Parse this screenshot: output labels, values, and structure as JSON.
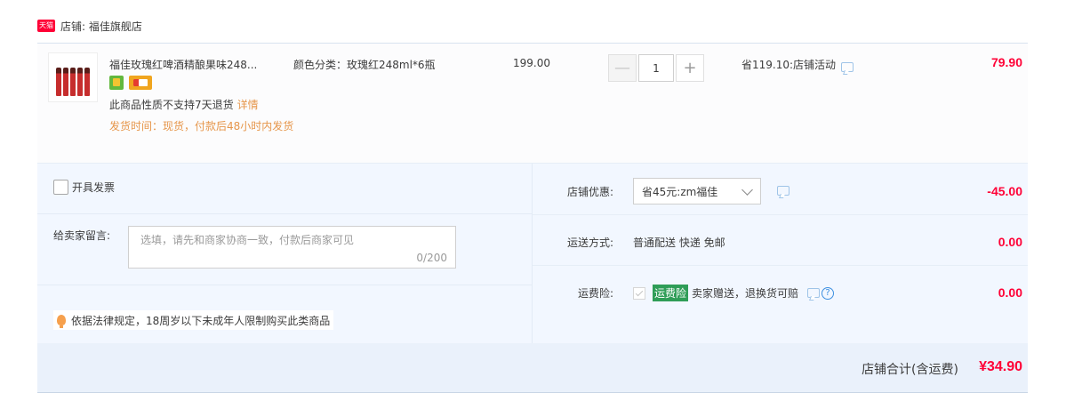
{
  "shop": {
    "badge": "天猫",
    "label": "店铺: 福佳旗舰店"
  },
  "item": {
    "title": "福佳玫瑰红啤酒精酿果味248...",
    "sku": "颜色分类：玫瑰红248ml*6瓶",
    "unit_price": "199.00",
    "notice": "此商品性质不支持7天退货",
    "detail_link": "详情",
    "ship_time": "发货时间：现货，付款后48小时内发货",
    "quantity": "1",
    "minus_label": "—",
    "plus_label": "+",
    "saving": "省119.10:店铺活动",
    "total": "79.90"
  },
  "extras": {
    "invoice_label": "开具发票",
    "message_label": "给卖家留言:",
    "message_placeholder": "选填，请先和商家协商一致，付款后商家可见",
    "message_counter": "0/200",
    "legal_notice": "依据法律规定，18周岁以下未成年人限制购买此类商品",
    "coupon_label": "店铺优惠:",
    "coupon_selected": "省45元:zm福佳",
    "coupon_amount": "-45.00",
    "shipping_label": "运送方式:",
    "shipping_method": "普通配送 快递 免邮",
    "shipping_amount": "0.00",
    "insurance_label": "运费险:",
    "insurance_badge": "运费险",
    "insurance_desc": "卖家赠送，退换货可赔",
    "insurance_amount": "0.00",
    "help_symbol": "?"
  },
  "footer": {
    "label": "店铺合计(含运费)",
    "amount": "¥34.90"
  },
  "colors": {
    "price_red": "#ff0036",
    "notice_orange": "#e6964b",
    "panel_blue": "#f2f7ff",
    "insurance_green": "#2f9d57"
  },
  "icons": [
    "tmall-badge-icon",
    "chat-icon",
    "chevron-down-icon",
    "bulb-icon",
    "help-icon",
    "checkbox-icon"
  ]
}
